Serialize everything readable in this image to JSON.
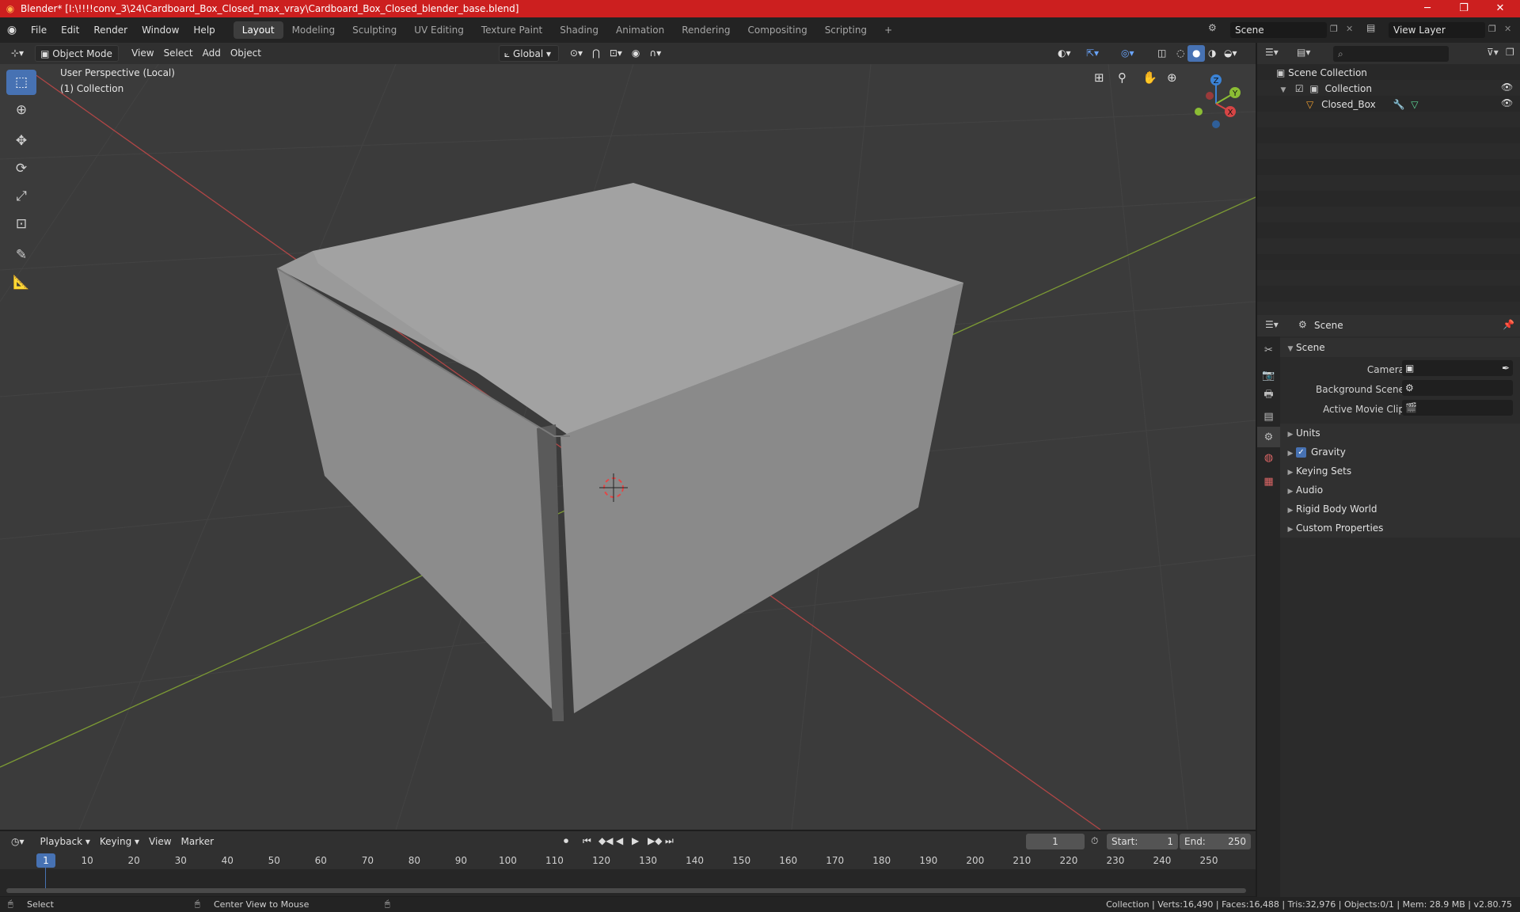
{
  "window": {
    "title": "Blender* [I:\\!!!!conv_3\\24\\Cardboard_Box_Closed_max_vray\\Cardboard_Box_Closed_blender_base.blend]",
    "minimize": "─",
    "maximize": "❐",
    "close": "✕"
  },
  "menu": {
    "items": [
      "File",
      "Edit",
      "Render",
      "Window",
      "Help"
    ],
    "workspaces": [
      "Layout",
      "Modeling",
      "Sculpting",
      "UV Editing",
      "Texture Paint",
      "Shading",
      "Animation",
      "Rendering",
      "Compositing",
      "Scripting"
    ],
    "active_workspace": "Layout",
    "add_tab": "+",
    "scene": "Scene",
    "view_layer": "View Layer"
  },
  "viewport_header": {
    "mode": "Object Mode",
    "items": [
      "View",
      "Select",
      "Add",
      "Object"
    ],
    "orientation": "Global"
  },
  "viewport": {
    "perspective_label": "User Perspective (Local)",
    "collection_label": "(1) Collection",
    "gizmo_axes": {
      "z": "Z",
      "y": "Y",
      "x": "X"
    },
    "colors": {
      "x_axis": "#d64545",
      "y_axis": "#8bbd34",
      "z_axis": "#3b83d6",
      "background": "#3b3b3b"
    }
  },
  "outliner": {
    "search_placeholder": "",
    "scene_collection": "Scene Collection",
    "collection": "Collection",
    "object": "Closed_Box"
  },
  "properties": {
    "header_title": "Scene",
    "panel_title": "Scene",
    "camera_label": "Camera",
    "background_scene_label": "Background Scene",
    "active_movie_clip_label": "Active Movie Clip",
    "sections": [
      "Units",
      "Gravity",
      "Keying Sets",
      "Audio",
      "Rigid Body World",
      "Custom Properties"
    ],
    "gravity_checked": true
  },
  "timeline": {
    "menus": [
      "Playback",
      "Keying",
      "View",
      "Marker"
    ],
    "current_frame": "1",
    "start_label": "Start:",
    "start_value": "1",
    "end_label": "End:",
    "end_value": "250",
    "ruler": [
      "1",
      "10",
      "20",
      "30",
      "40",
      "50",
      "60",
      "70",
      "80",
      "90",
      "100",
      "110",
      "120",
      "130",
      "140",
      "150",
      "160",
      "170",
      "180",
      "190",
      "200",
      "210",
      "220",
      "230",
      "240",
      "250"
    ]
  },
  "statusbar": {
    "select": "Select",
    "center_view": "Center View to Mouse",
    "stats": "Collection | Verts:16,490 | Faces:16,488 | Tris:32,976 | Objects:0/1 | Mem: 28.9 MB | v2.80.75"
  }
}
